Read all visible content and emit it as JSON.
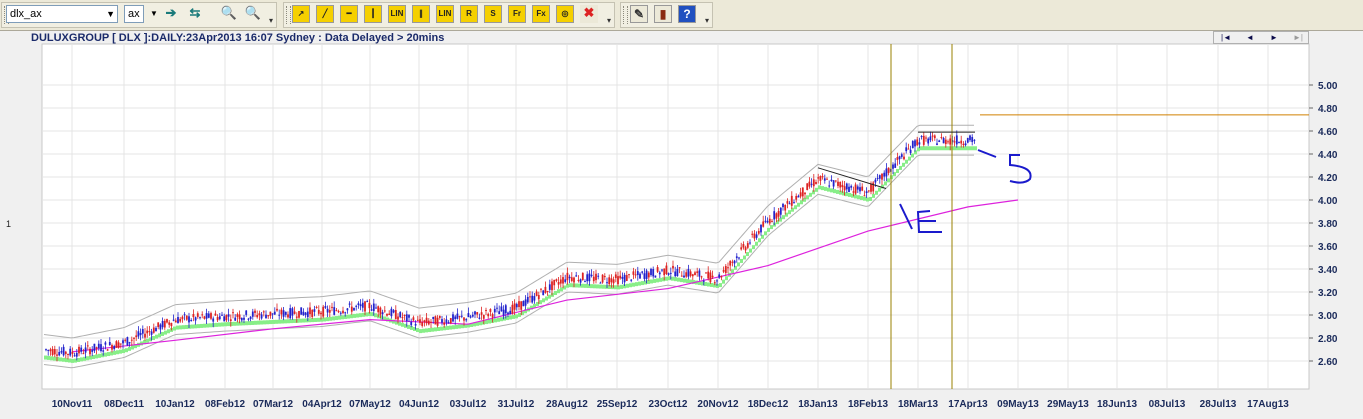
{
  "toolbar": {
    "symbol_value": "dlx_ax",
    "exchange_value": "ax",
    "buttons": [
      {
        "name": "go-icon",
        "glyph": "➔",
        "color": "#1a7a7a"
      },
      {
        "name": "refresh-icon",
        "glyph": "⇆",
        "color": "#1a7a7a"
      },
      {
        "name": "binoculars-icon",
        "glyph": "🔍",
        "color": "#333333"
      },
      {
        "name": "binoculars-disabled-icon",
        "glyph": "🔍",
        "color": "#999999"
      }
    ],
    "draw_tools": [
      {
        "name": "trend-tool-icon",
        "label": "↗",
        "bg": "#f5d000"
      },
      {
        "name": "line-tool-icon",
        "label": "╱",
        "bg": "#f5d000"
      },
      {
        "name": "horizontal-line-icon",
        "label": "━",
        "bg": "#f5d000"
      },
      {
        "name": "vertical-line-icon",
        "label": "┃",
        "bg": "#f5d000"
      },
      {
        "name": "lin-tool-icon",
        "label": "LIN",
        "bg": "#f5d000"
      },
      {
        "name": "parallel-tool-icon",
        "label": "∥",
        "bg": "#f5d000"
      },
      {
        "name": "lin-channel-icon",
        "label": "LIN",
        "bg": "#f5d000"
      },
      {
        "name": "r-tool-icon",
        "label": "R",
        "bg": "#f5d000"
      },
      {
        "name": "s-tool-icon",
        "label": "S",
        "bg": "#f5d000"
      },
      {
        "name": "fibonacci-tool-icon",
        "label": "Fr",
        "bg": "#f5d000"
      },
      {
        "name": "fibonacci-ext-icon",
        "label": "Fx",
        "bg": "#f5d000"
      },
      {
        "name": "text-tool-icon",
        "label": "◎",
        "bg": "#f5d000"
      },
      {
        "name": "delete-tool-icon",
        "label": "✖",
        "bg": "#ece9d8"
      }
    ],
    "misc_tools": [
      {
        "name": "edit-tool-icon",
        "label": "✎",
        "bg": "#ece9d8"
      },
      {
        "name": "book-icon",
        "label": "▮",
        "bg": "#ece9d8"
      },
      {
        "name": "help-icon",
        "label": "?",
        "bg": "#2050c0"
      }
    ]
  },
  "chart": {
    "title": "DULUXGROUP [ DLX ]:DAILY:23Apr2013 16:07 Sydney : Data Delayed > 20mins",
    "side_label": "1",
    "nav": [
      "|◄",
      "◄",
      "►",
      "►|"
    ]
  },
  "chart_data": {
    "type": "candlestick",
    "title": "DULUXGROUP [ DLX ]:DAILY:23Apr2013 16:07 Sydney : Data Delayed > 20mins",
    "x_tick_labels": [
      "10Nov11",
      "08Dec11",
      "10Jan12",
      "08Feb12",
      "07Mar12",
      "04Apr12",
      "07May12",
      "04Jun12",
      "03Jul12",
      "31Jul12",
      "28Aug12",
      "25Sep12",
      "23Oct12",
      "20Nov12",
      "18Dec12",
      "18Jan13",
      "18Feb13",
      "18Mar13",
      "17Apr13",
      "09May13",
      "29May13",
      "18Jun13",
      "08Jul13",
      "28Jul13",
      "17Aug13"
    ],
    "y_ticks": [
      "2.60",
      "2.80",
      "3.00",
      "3.20",
      "3.40",
      "3.60",
      "3.80",
      "4.00",
      "4.20",
      "4.40",
      "4.60",
      "4.80",
      "5.00"
    ],
    "ylim": [
      2.48,
      5.12
    ],
    "price_path": [
      {
        "date": "10Nov11",
        "close": 2.67
      },
      {
        "date": "08Dec11",
        "close": 2.76
      },
      {
        "date": "10Jan12",
        "close": 2.96
      },
      {
        "date": "08Feb12",
        "close": 2.99
      },
      {
        "date": "07Mar12",
        "close": 3.01
      },
      {
        "date": "04Apr12",
        "close": 3.03
      },
      {
        "date": "07May12",
        "close": 3.08
      },
      {
        "date": "04Jun12",
        "close": 2.93
      },
      {
        "date": "03Jul12",
        "close": 2.98
      },
      {
        "date": "31Jul12",
        "close": 3.06
      },
      {
        "date": "28Aug12",
        "close": 3.33
      },
      {
        "date": "25Sep12",
        "close": 3.31
      },
      {
        "date": "23Oct12",
        "close": 3.39
      },
      {
        "date": "20Nov12",
        "close": 3.32
      },
      {
        "date": "18Dec12",
        "close": 3.82
      },
      {
        "date": "18Jan13",
        "close": 4.18
      },
      {
        "date": "18Feb13",
        "close": 4.07
      },
      {
        "date": "18Mar13",
        "close": 4.52
      },
      {
        "date": "17Apr13",
        "close": 4.52
      }
    ],
    "moving_average": [
      {
        "date": "10Nov11",
        "value": 2.68
      },
      {
        "date": "10Jan12",
        "value": 2.78
      },
      {
        "date": "07Mar12",
        "value": 2.88
      },
      {
        "date": "07May12",
        "value": 2.96
      },
      {
        "date": "03Jul12",
        "value": 2.92
      },
      {
        "date": "28Aug12",
        "value": 3.13
      },
      {
        "date": "23Oct12",
        "value": 3.23
      },
      {
        "date": "18Dec12",
        "value": 3.43
      },
      {
        "date": "18Feb13",
        "value": 3.73
      },
      {
        "date": "17Apr13",
        "value": 3.94
      },
      {
        "date": "09May13",
        "value": 4.0
      }
    ],
    "horizontal_line": 4.74,
    "vertical_markers": [
      "18Mar13",
      "17Apr13"
    ],
    "annotations": [
      "5",
      "E"
    ],
    "grid": true,
    "colors": {
      "up": "#2222cc",
      "down": "#dd2222",
      "ma": "#dd22dd",
      "band": "#88ee88",
      "marker": "#9a8000",
      "hline": "#d08000",
      "handwriting": "#1a1acc"
    }
  }
}
